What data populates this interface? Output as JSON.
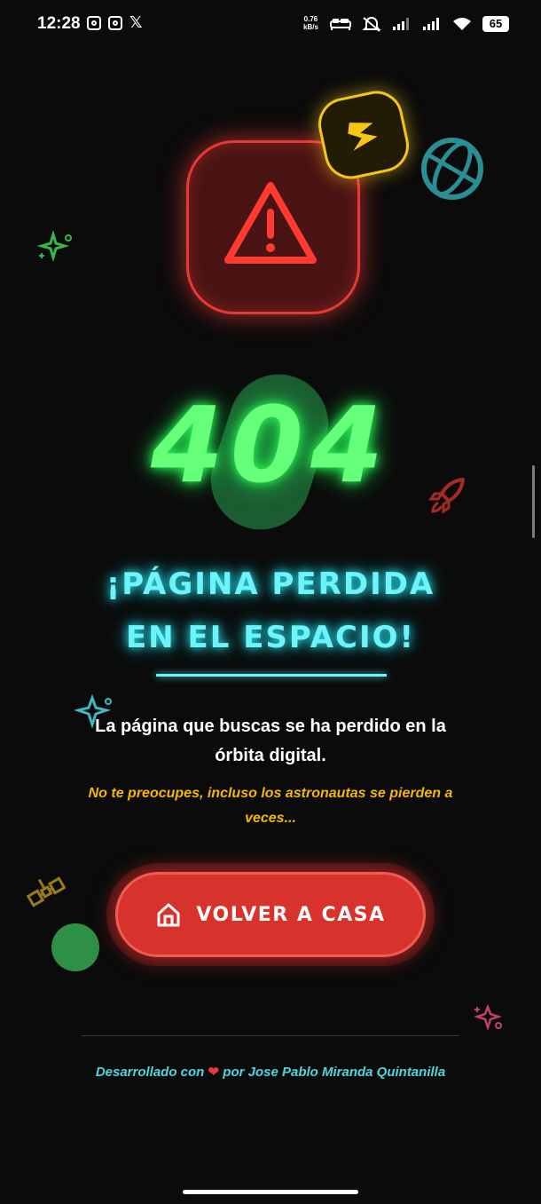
{
  "status_bar": {
    "time": "12:28",
    "app_icons": [
      "instagram-icon",
      "instagram-icon",
      "x-icon"
    ],
    "x_glyph": "𝕏",
    "net_speed_value": "0.76",
    "net_speed_unit": "kB/s",
    "battery": "65"
  },
  "error": {
    "code": "404",
    "title_line1": "¡PÁGINA PERDIDA",
    "title_line2": "EN EL ESPACIO!",
    "description_line1": "La página que buscas se ha perdido en la",
    "description_line2": "órbita digital.",
    "note_line1": "No te preocupes, incluso los astronautas se pierden a",
    "note_line2": "veces..."
  },
  "home_button": {
    "label": "VOLVER A CASA"
  },
  "footer": {
    "prefix": "Desarrollado con",
    "suffix": "por Jose Pablo Miranda Quintanilla"
  },
  "colors": {
    "background": "#0b0b0b",
    "neon_green": "#66ff7a",
    "neon_cyan": "#6ef3f9",
    "neon_red": "#e53935",
    "note_yellow": "#f5b700",
    "button_red": "#d8322d"
  }
}
